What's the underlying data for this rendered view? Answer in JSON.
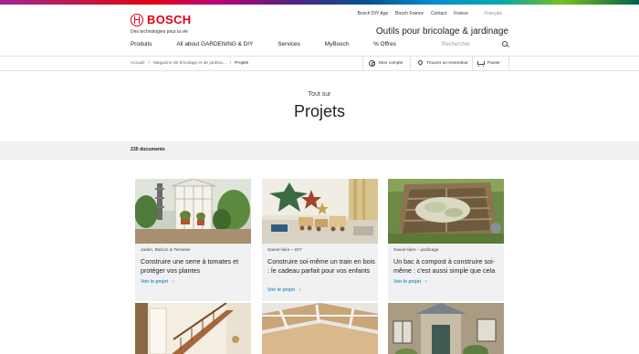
{
  "brand": {
    "name": "BOSCH",
    "tagline": "Des technologies pour la vie",
    "color": "#e20015"
  },
  "topnav": {
    "items": [
      "Bosch DIY App",
      "Bosch France",
      "Contact",
      "France"
    ],
    "language": "Français"
  },
  "site_title": "Outils pour bricolage & jardinage",
  "mainnav": {
    "items": [
      "Produits",
      "All about GARDENING & DIY",
      "Services",
      "MyBosch",
      "% Offres"
    ]
  },
  "search": {
    "placeholder": "Rechercher",
    "icon": "search-icon"
  },
  "breadcrumb": {
    "items": [
      "Accueil",
      "Magazine de bricolage et de jardina...",
      "Projets"
    ],
    "separator": "/"
  },
  "utility": {
    "account": "Mon compte",
    "dealer": "Trouver un revendeur",
    "cart": "Panier"
  },
  "hero": {
    "subtitle": "Tout sur",
    "title": "Projets"
  },
  "results": {
    "count_label": "235 documents"
  },
  "cards": [
    {
      "category": "Jardin, Balcon & Terrasse",
      "title": "Construire une serre à tomates et protéger vos plantes",
      "link": "Voir le projet",
      "chevron": "›"
    },
    {
      "category": "Savoir-faire – DIY",
      "title": "Construire soi-même un train en bois : le cadeau parfait pour vos enfants",
      "link": "Voir le projet",
      "chevron": "›"
    },
    {
      "category": "Savoir-faire – jardinage",
      "title": "Un bac à compost à construire soi-même : c'est aussi simple que cela",
      "link": "Voir le projet",
      "chevron": "›"
    }
  ],
  "colors": {
    "accent": "#e20015",
    "link": "#006ead",
    "band": "#eff1f2"
  }
}
